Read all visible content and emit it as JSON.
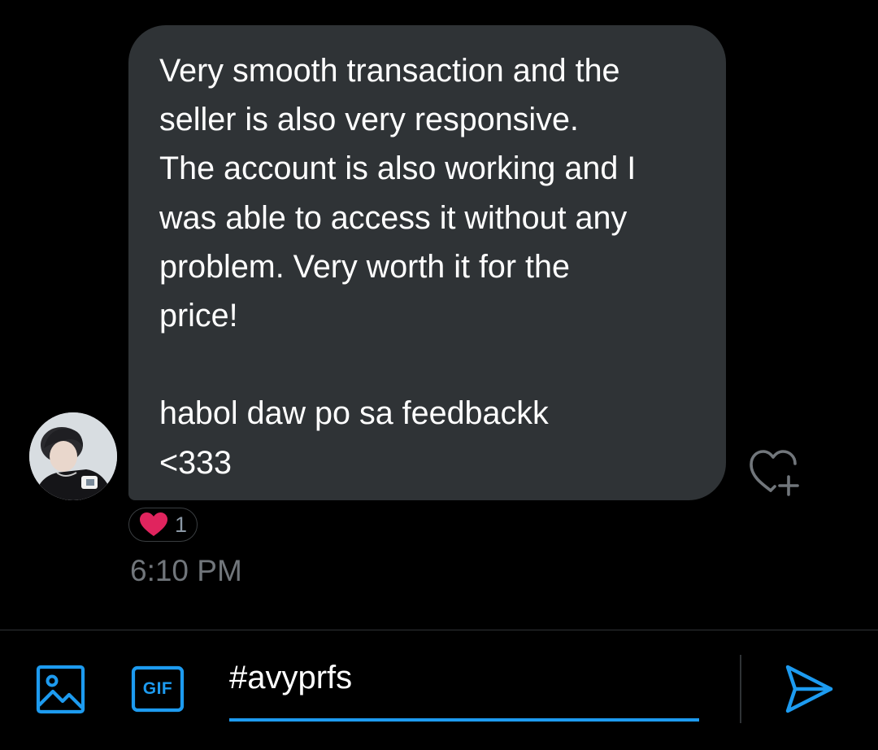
{
  "conversation": {
    "message": {
      "text": "Very smooth transaction and the\nseller is also very responsive.\nThe account is also working and I\nwas able to access it without any\nproblem. Very worth it for the\nprice!\n\nhabol daw po sa feedbackk\n<333",
      "reactions": {
        "icon": "heart-icon",
        "count": "1"
      },
      "timestamp": "6:10 PM"
    },
    "add_reaction_icon": "heart-plus-icon"
  },
  "composer": {
    "media_icon": "image-icon",
    "gif_label": "GIF",
    "input_value": "#avyprfs",
    "send_icon": "send-icon"
  },
  "colors": {
    "background": "#000000",
    "bubble": "#2f3336",
    "accent": "#1d9bf0",
    "heart": "#f91880",
    "muted_text": "#71767b"
  }
}
